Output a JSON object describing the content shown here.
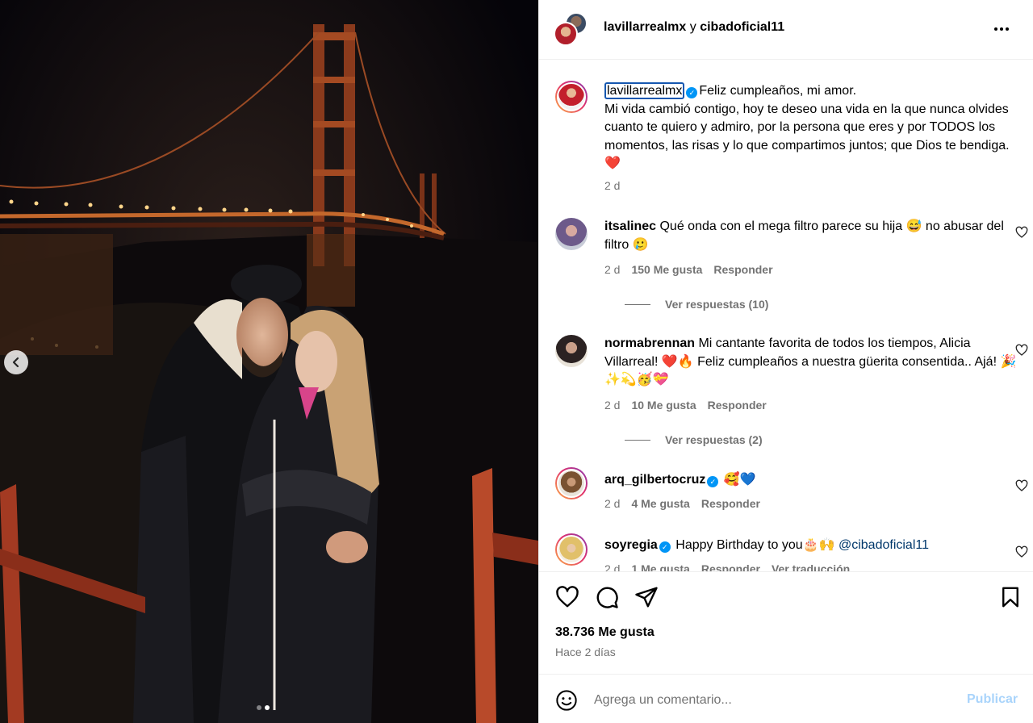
{
  "header": {
    "user1": "lavillarrealmx",
    "connector": "y",
    "user2": "cibadoficial11",
    "more_icon": "more-horizontal-icon"
  },
  "caption": {
    "username": "lavillarrealmx",
    "line1": "Feliz cumpleaños, mi amor.",
    "body": "Mi vida cambió contigo, hoy te deseo una vida en la que nunca olvides cuanto te quiero y admiro, por la persona que eres y por TODOS los momentos, las risas y lo que compartimos juntos; que Dios te bendiga. ❤️",
    "time": "2 d"
  },
  "comments": [
    {
      "username": "itsalinec",
      "text": "Qué onda con el mega filtro parece su hija 😅 no abusar del filtro 🥲",
      "time": "2 d",
      "likes": "150 Me gusta",
      "reply": "Responder",
      "view_replies": "Ver respuestas (10)"
    },
    {
      "username": "normabrennan",
      "text": "Mi cantante favorita de todos los tiempos, Alicia Villarreal! ❤️🔥 Feliz cumpleaños a nuestra güerita consentida.. Ajá! 🎉✨💫🥳💝",
      "time": "2 d",
      "likes": "10 Me gusta",
      "reply": "Responder",
      "view_replies": "Ver respuestas (2)"
    },
    {
      "username": "arq_gilbertocruz",
      "text": "🥰💙",
      "time": "2 d",
      "likes": "4 Me gusta",
      "reply": "Responder"
    },
    {
      "username": "soyregia",
      "text": "Happy Birthday to you🎂🙌",
      "mention": "@cibadoficial11",
      "time": "2 d",
      "likes": "1 Me gusta",
      "reply": "Responder",
      "translate": "Ver traducción"
    }
  ],
  "footer": {
    "likes": "38.736 Me gusta",
    "posted": "Hace 2 días",
    "comment_placeholder": "Agrega un comentario...",
    "publish": "Publicar"
  },
  "carousel": {
    "current": 2,
    "total": 2
  },
  "colors": {
    "link": "#00376b",
    "publish_disabled": "#a9d4fb",
    "verified": "#0095f6",
    "secondary_text": "#737373"
  }
}
